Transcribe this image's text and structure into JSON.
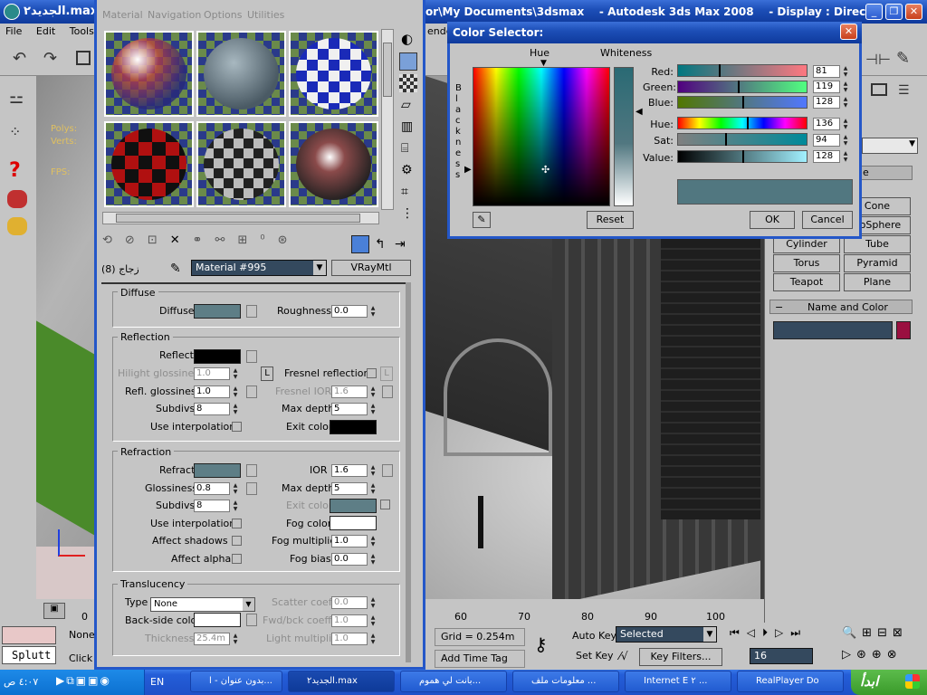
{
  "max_window": {
    "title_left": "الجديد٢.max",
    "title_right": "or\\My Documents\\3dsmax    - Autodesk 3ds Max 2008    - Display : Direc...",
    "menu": [
      "File",
      "Edit",
      "Tools",
      "G"
    ],
    "menu_right": "ende",
    "viewport_overlay": {
      "polys": "Polys:",
      "verts": "Verts:",
      "fps": "FPS:"
    },
    "ruler_right": [
      "60",
      "70",
      "80",
      "90",
      "100"
    ],
    "ruler_left": [
      "0"
    ],
    "grid": "Grid = 0.254m",
    "add_time_tag": "Add Time Tag",
    "auto_key": "Auto Key",
    "set_key": "Set Key",
    "selected": "Selected",
    "key_filters": "Key Filters...",
    "frame": "16",
    "none_label": "None",
    "click_label": "Click",
    "splutt": "Splutt",
    "command_panel": {
      "buttons": [
        "Cone",
        "eoSphere",
        "Cylinder",
        "Tube",
        "Torus",
        "Pyramid",
        "Teapot",
        "Plane"
      ],
      "partial_label": "e",
      "name_and_color": "Name and Color",
      "name_color_swatch": "#9a1040"
    }
  },
  "material_editor": {
    "menu": [
      "Material",
      "Navigation",
      "Options",
      "Utilities"
    ],
    "mat_id_label": "زجاج (8)",
    "material_name": "Material #995",
    "material_type": "VRayMtl",
    "diffuse": {
      "title": "Diffuse",
      "diffuse_label": "Diffuse",
      "diffuse_color": "#5e7e86",
      "roughness_label": "Roughness",
      "roughness": "0.0"
    },
    "reflection": {
      "title": "Reflection",
      "reflect_label": "Reflect",
      "reflect_color": "#000000",
      "hilight_label": "Hilight glossiness",
      "hilight": "1.0",
      "l_label": "L",
      "fresnel_label": "Fresnel reflections",
      "refl_gloss_label": "Refl. glossiness",
      "refl_gloss": "1.0",
      "fresnel_ior_label": "Fresnel IOR",
      "fresnel_ior": "1.6",
      "subdivs_label": "Subdivs",
      "subdivs": "8",
      "max_depth_label": "Max depth",
      "max_depth": "5",
      "use_interp_label": "Use interpolation",
      "exit_color_label": "Exit color",
      "exit_color": "#000000"
    },
    "refraction": {
      "title": "Refraction",
      "refract_label": "Refract",
      "refract_color": "#5e7e86",
      "ior_label": "IOR",
      "ior": "1.6",
      "glossiness_label": "Glossiness",
      "glossiness": "0.8",
      "max_depth_label": "Max depth",
      "max_depth": "5",
      "subdivs_label": "Subdivs",
      "subdivs": "8",
      "exit_color_label": "Exit color",
      "exit_color": "#5e7e86",
      "use_interp_label": "Use interpolation",
      "fog_color_label": "Fog color",
      "fog_color": "#ffffff",
      "affect_shadows_label": "Affect shadows",
      "fog_mult_label": "Fog multiplier",
      "fog_mult": "1.0",
      "affect_alpha_label": "Affect alpha",
      "fog_bias_label": "Fog bias",
      "fog_bias": "0.0"
    },
    "translucency": {
      "title": "Translucency",
      "type_label": "Type",
      "type_value": "None",
      "scatter_label": "Scatter coeff",
      "scatter": "0.0",
      "backside_label": "Back-side color",
      "backside_color": "#ffffff",
      "fwd_label": "Fwd/bck coeff",
      "fwd": "1.0",
      "thickness_label": "Thickness",
      "thickness": "25.4m",
      "light_mult_label": "Light multiplier",
      "light_mult": "1.0"
    }
  },
  "color_selector": {
    "title": "Color Selector:",
    "hue_label": "Hue",
    "whiteness_label": "Whiteness",
    "blackness_label": "Blackness",
    "red_label": "Red:",
    "red": "81",
    "green_label": "Green:",
    "green": "119",
    "blue_label": "Blue:",
    "blue": "128",
    "hue_field_label": "Hue:",
    "hue": "136",
    "sat_label": "Sat:",
    "sat": "94",
    "value_label": "Value:",
    "value": "128",
    "preview_color": "#517780",
    "reset": "Reset",
    "ok": "OK",
    "cancel": "Cancel"
  },
  "taskbar": {
    "clock": "٤:٠٧ ص",
    "lang": "EN",
    "items": [
      "بدون عنوان - ا...",
      "الجديد٢.max",
      "بانت لي هموم...",
      "معلومات ملف ...",
      "Internet E ٢ ...",
      "RealPlayer Do"
    ],
    "start": "ابدأ"
  }
}
